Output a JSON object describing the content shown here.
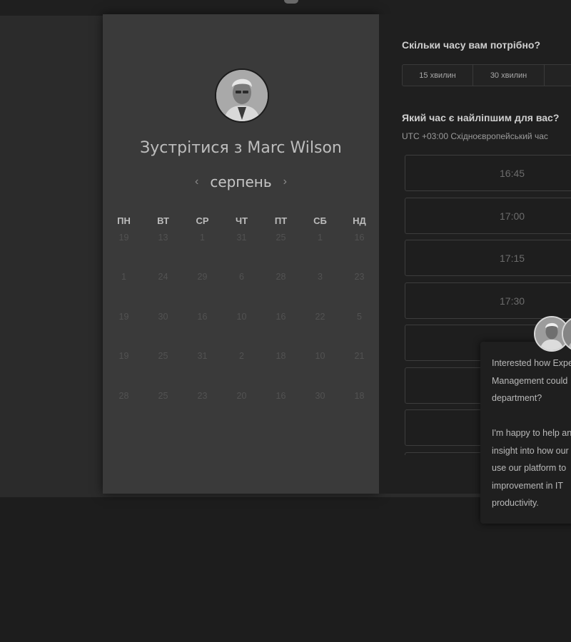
{
  "host": {
    "name": "Marc Wilson",
    "title": "Зустрітися з Marc Wilson"
  },
  "calendar": {
    "month": "серпень",
    "prev_icon": "chevron-left-icon",
    "next_icon": "chevron-right-icon",
    "weekdays": [
      "ПН",
      "ВТ",
      "СР",
      "ЧТ",
      "ПТ",
      "СБ",
      "НД"
    ],
    "weeks": [
      [
        "19",
        "13",
        "1",
        "31",
        "25",
        "1",
        "16"
      ],
      [
        "1",
        "24",
        "29",
        "6",
        "28",
        "3",
        "23"
      ],
      [
        "19",
        "30",
        "16",
        "10",
        "16",
        "22",
        "5"
      ],
      [
        "19",
        "25",
        "31",
        "2",
        "18",
        "10",
        "21"
      ],
      [
        "28",
        "25",
        "23",
        "20",
        "16",
        "30",
        "18"
      ]
    ]
  },
  "booking": {
    "duration_question": "Скільки часу вам потрібно?",
    "durations": [
      "15 хвилин",
      "30 хвилин",
      ""
    ],
    "time_question": "Який час є найліпшим для вас?",
    "timezone": "UTC +03:00 Східноєвропейський час",
    "slots": [
      "16:45",
      "17:00",
      "17:15",
      "17:30",
      "",
      "",
      "",
      ""
    ]
  },
  "chat": {
    "message": "Interested how Expert\nManagement could\ndepartment?\n\nI'm happy to help and\ninsight into how our\nuse our platform to\nimprovement in IT\nproductivity."
  },
  "colors": {
    "page_background": "#1d1d1d",
    "calendar_panel": "#3a3a3a",
    "booking_panel": "#1f1f1f"
  }
}
